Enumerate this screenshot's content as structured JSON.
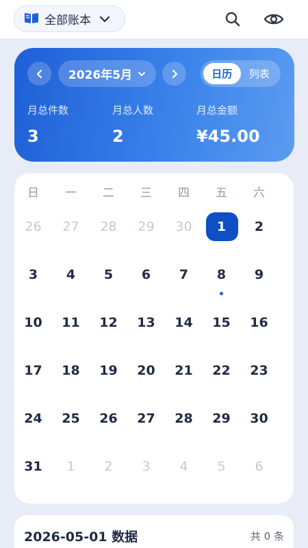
{
  "header": {
    "account_label": "全部账本",
    "icons": [
      "book-icon",
      "chevron-down-icon",
      "search-icon",
      "eye-icon"
    ]
  },
  "summary": {
    "month_label": "2026年5月",
    "view_calendar": "日历",
    "view_list": "列表",
    "active_view": "日历",
    "stats": [
      {
        "label": "月总件数",
        "value": "3"
      },
      {
        "label": "月总人数",
        "value": "2"
      },
      {
        "label": "月总金额",
        "value": "¥45.00"
      }
    ]
  },
  "calendar": {
    "weekdays": [
      "日",
      "一",
      "二",
      "三",
      "四",
      "五",
      "六"
    ],
    "weeks": [
      [
        "26",
        "27",
        "28",
        "29",
        "30",
        "1",
        "2"
      ],
      [
        "3",
        "4",
        "5",
        "6",
        "7",
        "8",
        "9"
      ],
      [
        "10",
        "11",
        "12",
        "13",
        "14",
        "15",
        "16"
      ],
      [
        "17",
        "18",
        "19",
        "20",
        "21",
        "22",
        "23"
      ],
      [
        "24",
        "25",
        "26",
        "27",
        "28",
        "29",
        "30"
      ],
      [
        "31",
        "1",
        "2",
        "3",
        "4",
        "5",
        "6"
      ]
    ],
    "selected_date": "1",
    "days_with_records": [
      "8"
    ]
  },
  "data_section": {
    "title": "2026-05-01 数据",
    "count_label": "共 0 条"
  },
  "colors": {
    "accent": "#0e4fc6",
    "background": "#e7ecf6",
    "text": "#1f2a44",
    "muted": "#c3c9d4"
  }
}
